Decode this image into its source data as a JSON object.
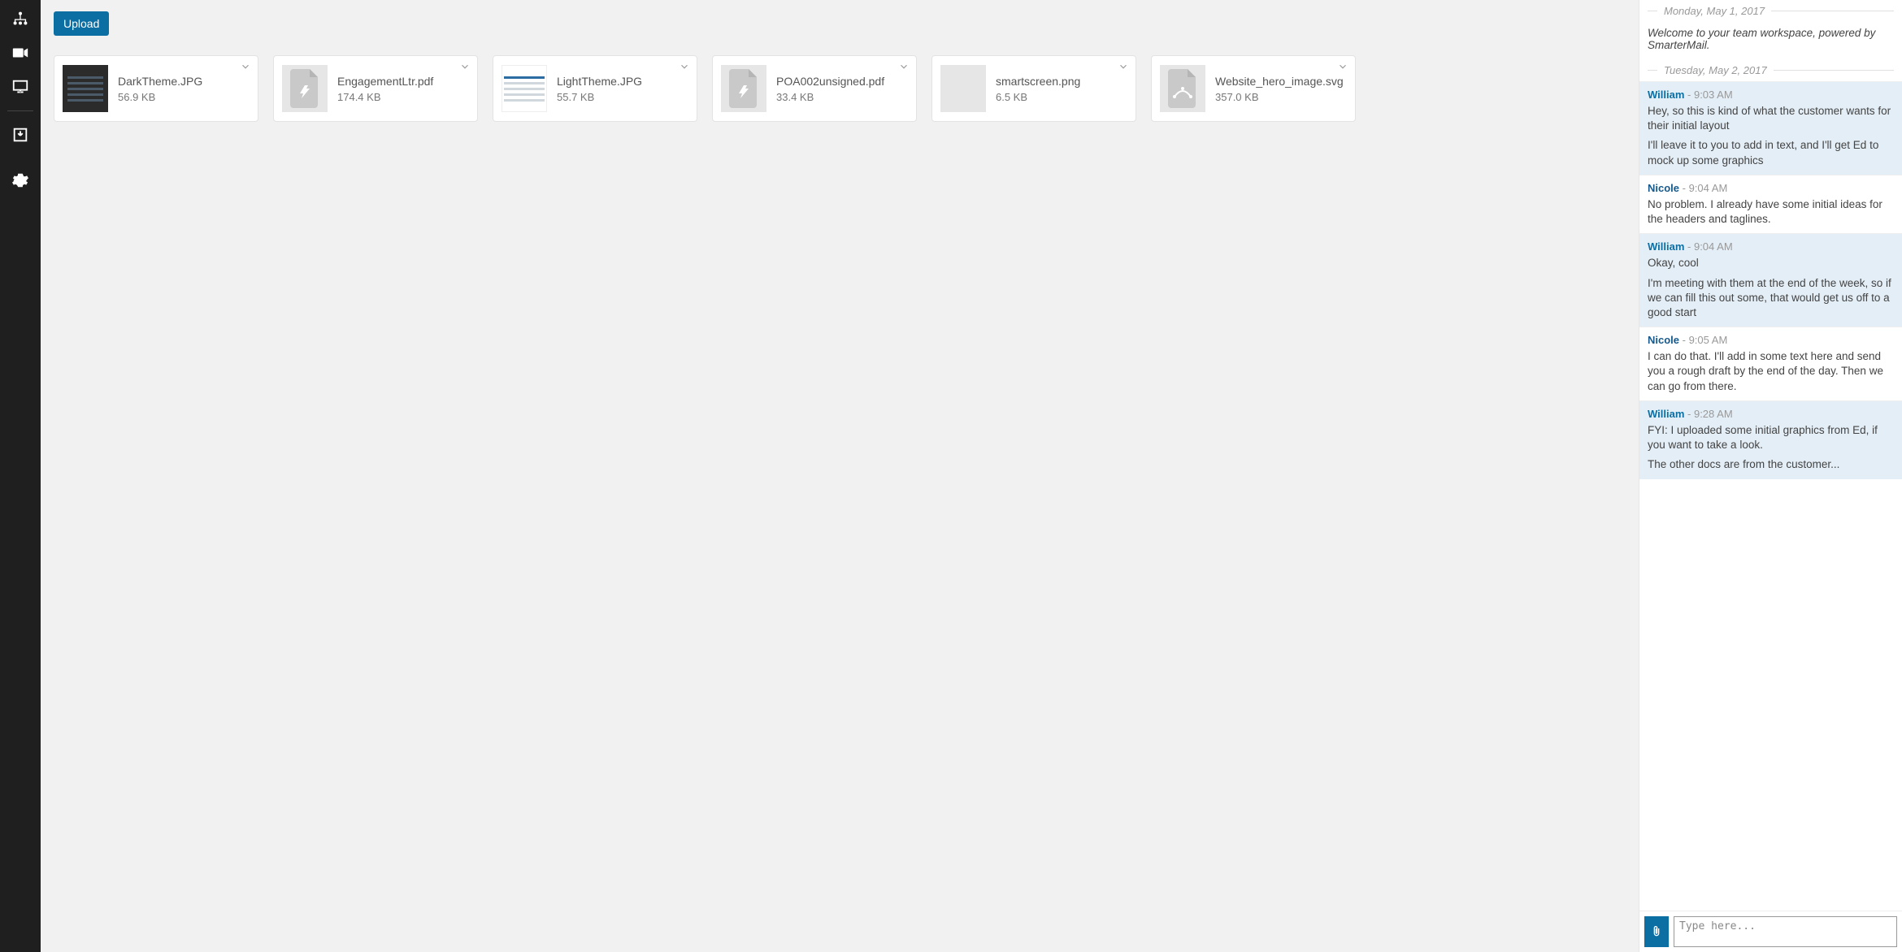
{
  "toolbar": {
    "upload_label": "Upload"
  },
  "rail": {
    "items": [
      "connections-icon",
      "video-icon",
      "monitor-icon",
      "inbox-download-icon",
      "settings-icon"
    ]
  },
  "files": [
    {
      "name": "DarkTheme.JPG",
      "size": "56.9 KB",
      "thumb": "dark"
    },
    {
      "name": "EngagementLtr.pdf",
      "size": "174.4 KB",
      "thumb": "pdf"
    },
    {
      "name": "LightTheme.JPG",
      "size": "55.7 KB",
      "thumb": "light"
    },
    {
      "name": "POA002unsigned.pdf",
      "size": "33.4 KB",
      "thumb": "pdf"
    },
    {
      "name": "smartscreen.png",
      "size": "6.5 KB",
      "thumb": "blurry"
    },
    {
      "name": "Website_hero_image.svg",
      "size": "357.0 KB",
      "thumb": "svg"
    }
  ],
  "chat": {
    "dates": {
      "d0": "Monday, May 1, 2017",
      "d1": "Tuesday, May 2, 2017"
    },
    "welcome": "Welcome to your team workspace, powered by SmarterMail.",
    "messages": [
      {
        "author": "William",
        "time": "9:03 AM",
        "style": "william",
        "lines": [
          "Hey, so this is kind of what the customer wants for their initial layout",
          "I'll leave it to you to add in text, and I'll get Ed to mock up some graphics"
        ]
      },
      {
        "author": "Nicole",
        "time": "9:04 AM",
        "style": "nicole",
        "lines": [
          "No problem. I already have some initial ideas for the headers and taglines."
        ]
      },
      {
        "author": "William",
        "time": "9:04 AM",
        "style": "william",
        "lines": [
          "Okay, cool",
          "I'm meeting with them at the end of the week, so if we can fill this out some, that would get us off to a good start"
        ]
      },
      {
        "author": "Nicole",
        "time": "9:05 AM",
        "style": "nicole",
        "lines": [
          "I can do that. I'll add in some text here and send you a rough draft by the end of the day. Then we can go from there."
        ]
      },
      {
        "author": "William",
        "time": "9:28 AM",
        "style": "william",
        "lines": [
          "FYI: I uploaded some initial graphics from Ed, if you want to take a look.",
          "The other docs are from the customer..."
        ]
      }
    ],
    "compose_placeholder": "Type here..."
  }
}
